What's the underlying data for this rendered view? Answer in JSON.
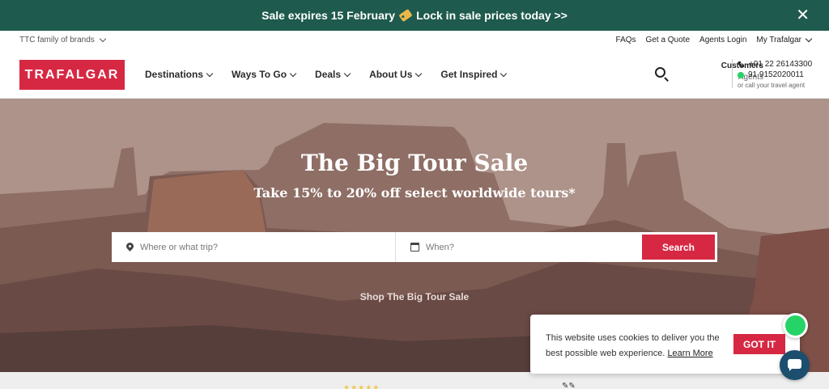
{
  "promo": {
    "text_before": "Sale expires 15 February",
    "text_after": "Lock in sale prices today >>",
    "close_label": "✕"
  },
  "util": {
    "brands_label": "TTC family of brands",
    "links": [
      "FAQs",
      "Get a Quote",
      "Agents Login",
      "My Trafalgar"
    ]
  },
  "nav": {
    "logo": "TRAFALGAR",
    "menu": [
      "Destinations",
      "Ways To Go",
      "Deals",
      "About Us",
      "Get Inspired"
    ],
    "contact": {
      "customers": "Customers",
      "agents": "Agents",
      "phone": "+91 22 26143300",
      "whatsapp": "91 9152020011",
      "note": "or call your travel agent"
    }
  },
  "hero": {
    "title": "The Big Tour Sale",
    "subtitle": "Take 15% to 20% off select worldwide tours*",
    "where_placeholder": "Where or what trip?",
    "when_placeholder": "When?",
    "search_label": "Search",
    "shop_link": "Shop The Big Tour Sale"
  },
  "cookie": {
    "message": "This website uses cookies to deliver you the best possible web experience.",
    "learn_more": "Learn More",
    "accept_label": "GOT IT"
  },
  "colors": {
    "brand_red": "#d72843",
    "promo_green": "#1e5a4e",
    "whatsapp_green": "#25d366",
    "chat_blue": "#1c4e6e"
  }
}
